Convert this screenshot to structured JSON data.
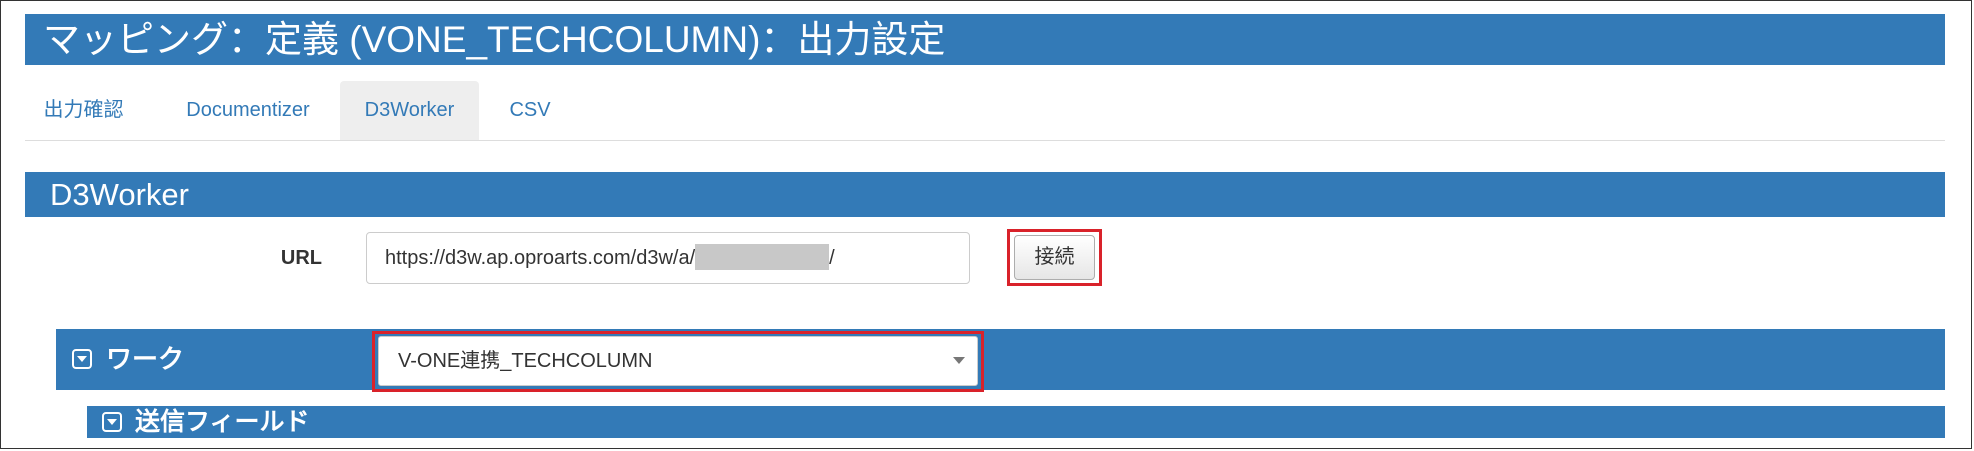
{
  "header": {
    "title": "マッピング：定義 (VONE_TECHCOLUMN)：出力設定"
  },
  "tabs": [
    {
      "label": "出力確認",
      "active": false
    },
    {
      "label": "Documentizer",
      "active": false
    },
    {
      "label": "D3Worker",
      "active": true
    },
    {
      "label": "CSV",
      "active": false
    }
  ],
  "section": {
    "title": "D3Worker"
  },
  "url_field": {
    "label": "URL",
    "value_prefix": "https://d3w.ap.oproarts.com/d3w/a/",
    "value_suffix": "/"
  },
  "connect_button": {
    "label": "接続"
  },
  "work": {
    "label": "ワーク",
    "selected": "V-ONE連携_TECHCOLUMN",
    "icon": "collapse-icon"
  },
  "send_fields": {
    "label": "送信フィールド",
    "icon": "collapse-icon"
  },
  "colors": {
    "primary": "#337ab7",
    "highlight": "#d9222a",
    "tab_active_bg": "#eeeeee"
  }
}
